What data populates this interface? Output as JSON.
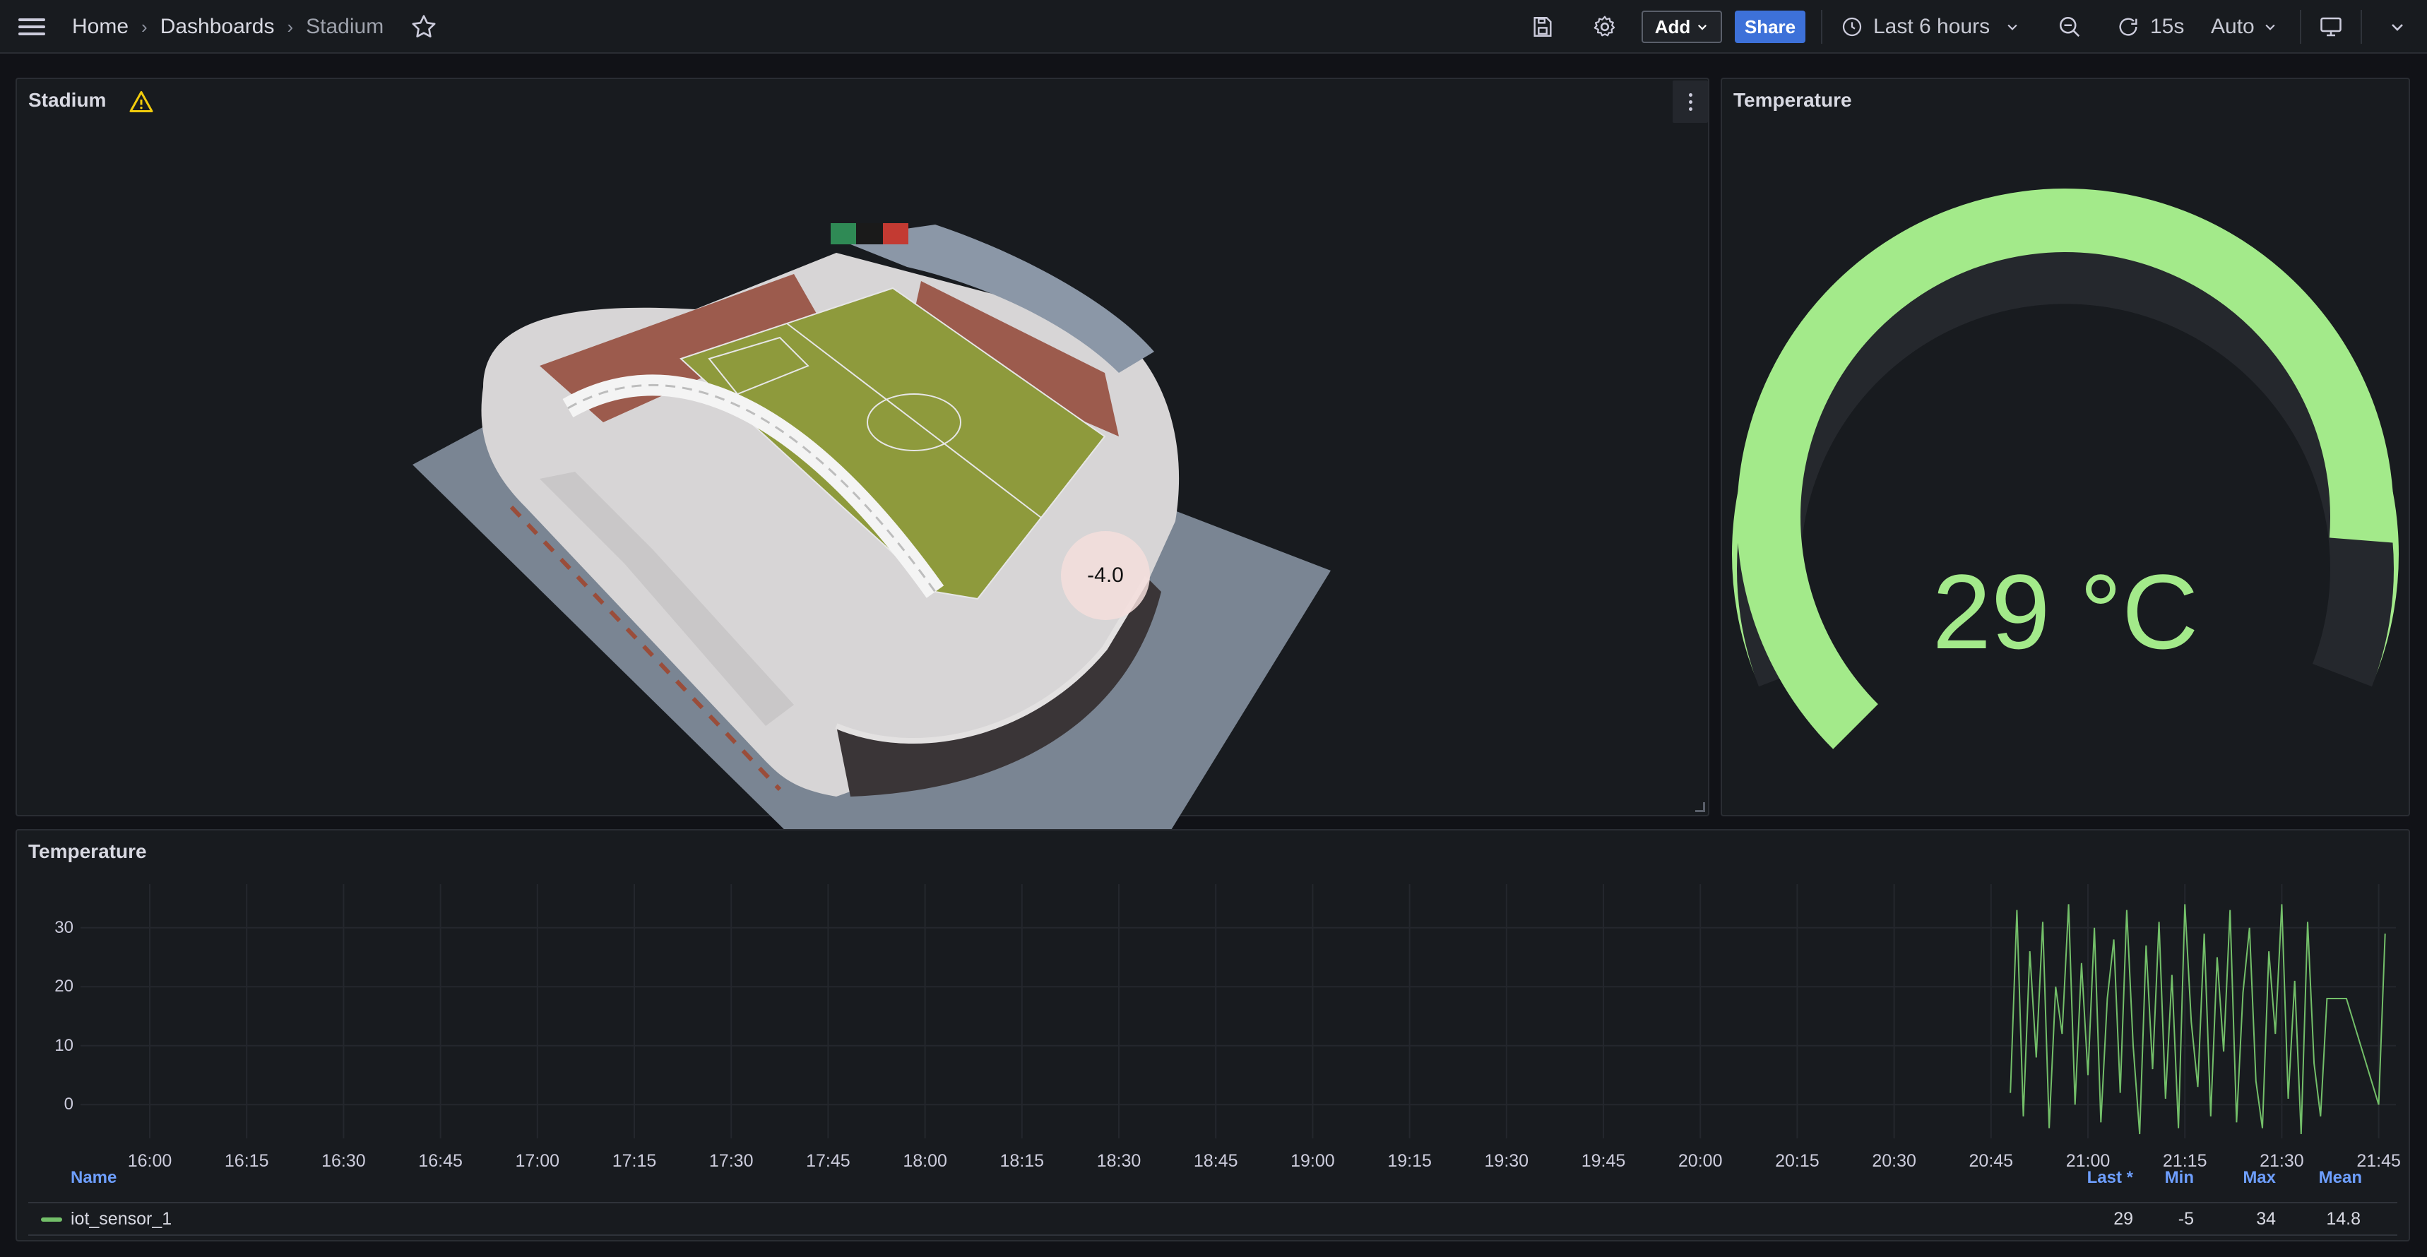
{
  "breadcrumb": {
    "home": "Home",
    "dashboards": "Dashboards",
    "current": "Stadium"
  },
  "toolbar": {
    "add_label": "Add",
    "share_label": "Share",
    "time_range": "Last 6 hours",
    "refresh_interval": "15s",
    "auto_label": "Auto"
  },
  "icons": {
    "menu": "hamburger-icon",
    "star": "star-icon",
    "save": "save-icon",
    "settings": "gear-icon",
    "clock": "clock-icon",
    "zoom_out": "zoom-out-icon",
    "refresh": "refresh-icon",
    "tv": "tv-mode-icon",
    "warning": "warning-icon"
  },
  "colors": {
    "accent_blue": "#3d71d9",
    "series_green": "#73bf69",
    "gauge_green": "#a3ea8a",
    "gauge_orange": "#f2a65a",
    "warning_yellow": "#f2cc0c",
    "legend_header": "#6e9fff"
  },
  "panels": {
    "stadium": {
      "title": "Stadium",
      "sensor_value": "-4.0"
    },
    "gauge": {
      "title": "Temperature",
      "value": "29 °C",
      "numeric_value": 29,
      "unit": "°C",
      "fill_fraction": 0.85
    },
    "timeseries": {
      "title": "Temperature",
      "legend": {
        "headers": {
          "name": "Name",
          "last": "Last *",
          "min": "Min",
          "max": "Max",
          "mean": "Mean"
        },
        "rows": [
          {
            "name": "iot_sensor_1",
            "last": "29",
            "min": "-5",
            "max": "34",
            "mean": "14.8"
          }
        ]
      }
    }
  },
  "chart_data": {
    "type": "line",
    "title": "Temperature",
    "xlabel": "",
    "ylabel": "",
    "x_ticks": [
      "16:00",
      "16:15",
      "16:30",
      "16:45",
      "17:00",
      "17:15",
      "17:30",
      "17:45",
      "18:00",
      "18:15",
      "18:30",
      "18:45",
      "19:00",
      "19:15",
      "19:30",
      "19:45",
      "20:00",
      "20:15",
      "20:30",
      "20:45",
      "21:00",
      "21:15",
      "21:30",
      "21:45"
    ],
    "y_ticks": [
      "30",
      "20",
      "10",
      "0"
    ],
    "ylim": [
      -5,
      35
    ],
    "grid": true,
    "legend": "bottom",
    "series": [
      {
        "name": "iot_sensor_1",
        "color": "#73bf69",
        "x": [
          "20:48",
          "20:49",
          "20:50",
          "20:51",
          "20:52",
          "20:53",
          "20:54",
          "20:55",
          "20:56",
          "20:57",
          "20:58",
          "20:59",
          "21:00",
          "21:01",
          "21:02",
          "21:03",
          "21:04",
          "21:05",
          "21:06",
          "21:07",
          "21:08",
          "21:09",
          "21:10",
          "21:11",
          "21:12",
          "21:13",
          "21:14",
          "21:15",
          "21:16",
          "21:17",
          "21:18",
          "21:19",
          "21:20",
          "21:21",
          "21:22",
          "21:23",
          "21:24",
          "21:25",
          "21:26",
          "21:27",
          "21:28",
          "21:29",
          "21:30",
          "21:31",
          "21:32",
          "21:33",
          "21:34",
          "21:35",
          "21:36",
          "21:37",
          "21:38",
          "21:39",
          "21:40",
          "21:45",
          "21:46"
        ],
        "values": [
          2,
          33,
          -2,
          26,
          8,
          31,
          -4,
          20,
          12,
          34,
          0,
          24,
          5,
          30,
          -3,
          18,
          28,
          2,
          33,
          10,
          -5,
          27,
          6,
          31,
          1,
          22,
          -4,
          34,
          14,
          3,
          29,
          -2,
          25,
          9,
          33,
          -3,
          19,
          30,
          4,
          -4,
          26,
          12,
          34,
          1,
          21,
          -5,
          31,
          7,
          -2,
          18,
          18,
          18,
          18,
          0,
          29
        ]
      }
    ]
  }
}
